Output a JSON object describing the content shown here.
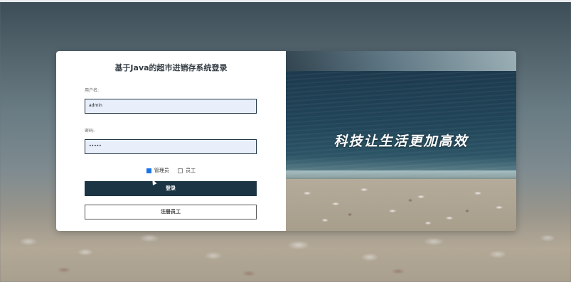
{
  "login": {
    "title": "基于Java的超市进销存系统登录",
    "username_label": "用户名:",
    "username_value": "admin",
    "password_label": "密码:",
    "password_value": "•••••",
    "roles": [
      {
        "label": "管理员",
        "checked": true
      },
      {
        "label": "员工",
        "checked": false
      }
    ],
    "login_button": "登录",
    "register_button": "注册员工"
  },
  "banner": {
    "slogan": "科技让生活更加高效"
  },
  "colors": {
    "primary_dark": "#1c3544",
    "input_bg": "#e8eefa",
    "checkbox_checked": "#1a73e8"
  }
}
